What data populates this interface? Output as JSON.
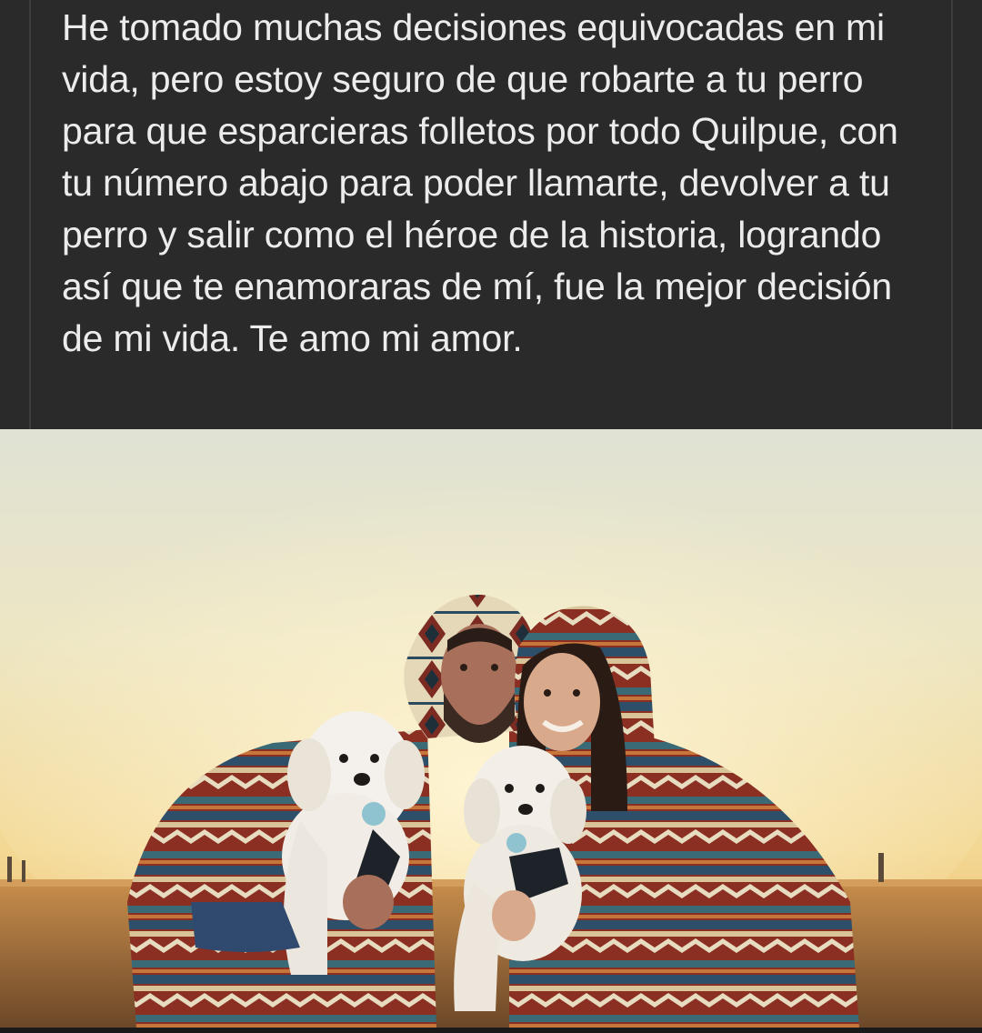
{
  "post": {
    "text": "He tomado muchas decisiones equivocadas en mi vida, pero estoy seguro de que robarte a tu perro para que esparcieras folletos por todo Quilpue, con tu número abajo para poder llamarte, devolver a tu perro y salir como el héroe de la historia, logrando así que te enamoraras de mí, fue la mejor decisión de mi vida. Te amo mi amor."
  },
  "colors": {
    "background": "#2a2a2b",
    "text": "#ececec",
    "divider": "#3c3c3e"
  }
}
